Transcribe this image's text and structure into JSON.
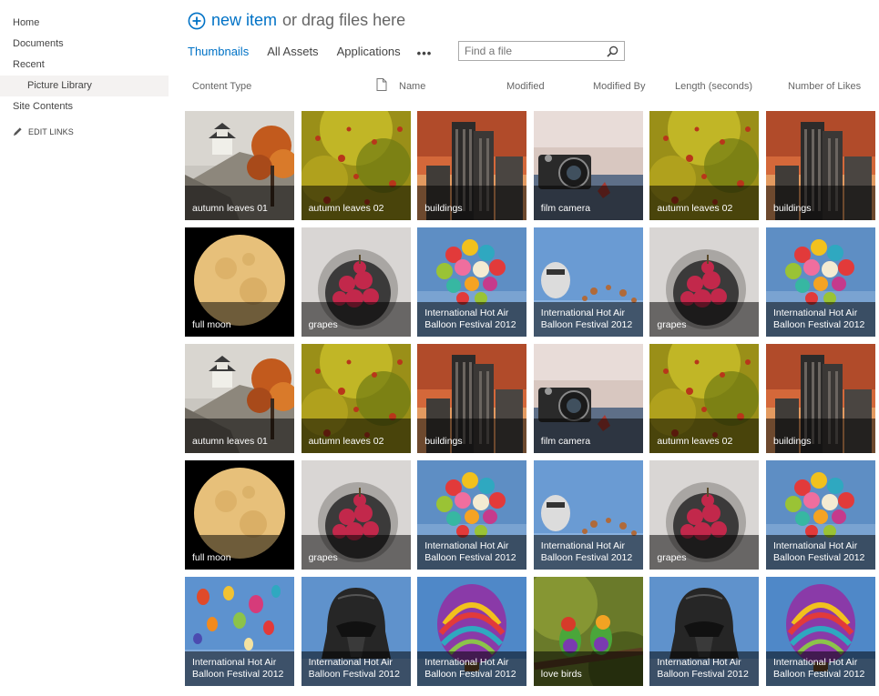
{
  "nav": {
    "items": [
      "Home",
      "Documents",
      "Recent"
    ],
    "sub_item": "Picture Library",
    "site_contents": "Site Contents",
    "edit_links": "EDIT LINKS"
  },
  "header": {
    "new_item": "new item",
    "drag_text": "or drag files here"
  },
  "views": {
    "items": [
      "Thumbnails",
      "All Assets",
      "Applications"
    ],
    "active": "Thumbnails",
    "more": "•••"
  },
  "search": {
    "placeholder": "Find a file"
  },
  "columns": [
    "Content Type",
    "Name",
    "Modified",
    "Modified By",
    "Length (seconds)",
    "Number of Likes"
  ],
  "tiles": [
    {
      "name": "autumn leaves 01",
      "icon": "castle-autumn"
    },
    {
      "name": "autumn leaves 02",
      "icon": "leaves"
    },
    {
      "name": "buildings",
      "icon": "buildings"
    },
    {
      "name": "film camera",
      "icon": "camera"
    },
    {
      "name": "autumn leaves 02",
      "icon": "leaves"
    },
    {
      "name": "buildings",
      "icon": "buildings"
    },
    {
      "name": "full moon",
      "icon": "moon"
    },
    {
      "name": "grapes",
      "icon": "grapes"
    },
    {
      "name": "International Hot Air Balloon Festival 2012",
      "icon": "balloons-cluster"
    },
    {
      "name": "International Hot Air Balloon Festival 2012",
      "icon": "balloon-launch"
    },
    {
      "name": "grapes",
      "icon": "grapes"
    },
    {
      "name": "International Hot Air Balloon Festival 2012",
      "icon": "balloons-cluster"
    },
    {
      "name": "autumn leaves 01",
      "icon": "castle-autumn"
    },
    {
      "name": "autumn leaves 02",
      "icon": "leaves"
    },
    {
      "name": "buildings",
      "icon": "buildings"
    },
    {
      "name": "film camera",
      "icon": "camera"
    },
    {
      "name": "autumn leaves 02",
      "icon": "leaves"
    },
    {
      "name": "buildings",
      "icon": "buildings"
    },
    {
      "name": "full moon",
      "icon": "moon"
    },
    {
      "name": "grapes",
      "icon": "grapes"
    },
    {
      "name": "International Hot Air Balloon Festival 2012",
      "icon": "balloons-cluster"
    },
    {
      "name": "International Hot Air Balloon Festival 2012",
      "icon": "balloon-launch"
    },
    {
      "name": "grapes",
      "icon": "grapes"
    },
    {
      "name": "International Hot Air Balloon Festival 2012",
      "icon": "balloons-cluster"
    },
    {
      "name": "International Hot Air Balloon Festival 2012",
      "icon": "balloons-sky"
    },
    {
      "name": "International Hot Air Balloon Festival 2012",
      "icon": "helmet-balloon"
    },
    {
      "name": "International Hot Air Balloon Festival 2012",
      "icon": "striped-balloon"
    },
    {
      "name": "love birds",
      "icon": "birds"
    },
    {
      "name": "International Hot Air Balloon Festival 2012",
      "icon": "helmet-balloon"
    },
    {
      "name": "International Hot Air Balloon Festival 2012",
      "icon": "striped-balloon"
    }
  ],
  "colors": {
    "accent": "#0072c6",
    "nav_selected_bg": "#f4f2f1"
  }
}
